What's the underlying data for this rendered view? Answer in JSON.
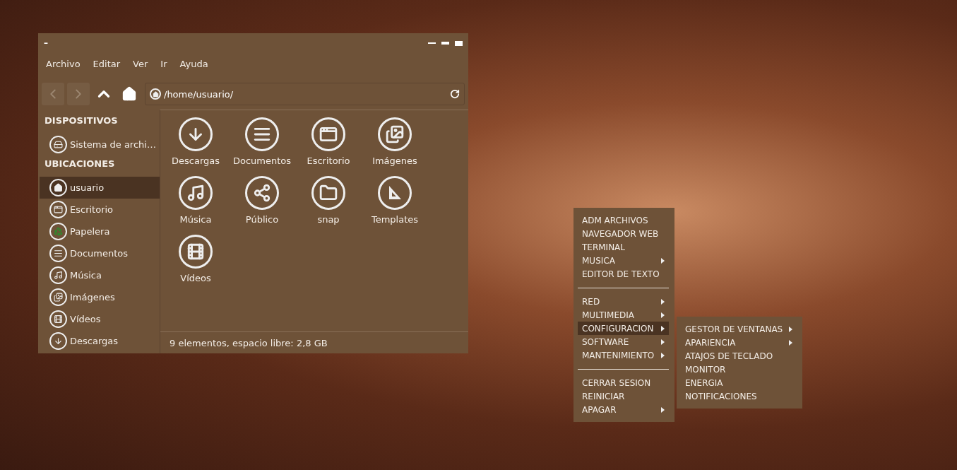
{
  "window": {
    "title": "–",
    "menu_bar": [
      "Archivo",
      "Editar",
      "Ver",
      "Ir",
      "Ayuda"
    ],
    "toolbar": {
      "back_disabled": true,
      "forward_disabled": true,
      "path": "/home/usuario/"
    },
    "sidebar": {
      "sections": [
        {
          "heading": "DISPOSITIVOS",
          "items": [
            {
              "label": "Sistema de archi…",
              "selected": false
            }
          ]
        },
        {
          "heading": "UBICACIONES",
          "items": [
            {
              "label": "usuario",
              "selected": true
            },
            {
              "label": "Escritorio",
              "selected": false
            },
            {
              "label": "Papelera",
              "selected": false
            },
            {
              "label": "Documentos",
              "selected": false
            },
            {
              "label": "Música",
              "selected": false
            },
            {
              "label": "Imágenes",
              "selected": false
            },
            {
              "label": "Vídeos",
              "selected": false
            },
            {
              "label": "Descargas",
              "selected": false
            }
          ]
        }
      ]
    },
    "files": [
      "Descargas",
      "Documentos",
      "Escritorio",
      "Imágenes",
      "Música",
      "Público",
      "snap",
      "Templates",
      "Vídeos"
    ],
    "status_bar": "9 elementos, espacio libre: 2,8 GB"
  },
  "menu": {
    "items": [
      {
        "kind": "item",
        "label": "ADM ARCHIVOS",
        "submenu": false,
        "selected": false
      },
      {
        "kind": "item",
        "label": "NAVEGADOR WEB",
        "submenu": false,
        "selected": false
      },
      {
        "kind": "item",
        "label": "TERMINAL",
        "submenu": false,
        "selected": false
      },
      {
        "kind": "item",
        "label": "MUSICA",
        "submenu": true,
        "selected": false
      },
      {
        "kind": "item",
        "label": "EDITOR DE TEXTO",
        "submenu": false,
        "selected": false
      },
      {
        "kind": "separator"
      },
      {
        "kind": "item",
        "label": "RED",
        "submenu": true,
        "selected": false
      },
      {
        "kind": "item",
        "label": "MULTIMEDIA",
        "submenu": true,
        "selected": false
      },
      {
        "kind": "item",
        "label": "CONFIGURACION",
        "submenu": true,
        "selected": true
      },
      {
        "kind": "item",
        "label": "SOFTWARE",
        "submenu": true,
        "selected": false
      },
      {
        "kind": "item",
        "label": "MANTENIMIENTO",
        "submenu": true,
        "selected": false
      },
      {
        "kind": "separator"
      },
      {
        "kind": "item",
        "label": "CERRAR SESION",
        "submenu": false,
        "selected": false
      },
      {
        "kind": "item",
        "label": "REINICIAR",
        "submenu": false,
        "selected": false
      },
      {
        "kind": "item",
        "label": "APAGAR",
        "submenu": true,
        "selected": false
      }
    ]
  },
  "submenu": {
    "items": [
      {
        "kind": "item",
        "label": "GESTOR DE VENTANAS",
        "submenu": true,
        "selected": false
      },
      {
        "kind": "item",
        "label": "APARIENCIA",
        "submenu": true,
        "selected": false
      },
      {
        "kind": "item",
        "label": "ATAJOS DE TECLADO",
        "submenu": false,
        "selected": false
      },
      {
        "kind": "item",
        "label": "MONITOR",
        "submenu": false,
        "selected": false
      },
      {
        "kind": "item",
        "label": "ENERGIA",
        "submenu": false,
        "selected": false
      },
      {
        "kind": "item",
        "label": "NOTIFICACIONES",
        "submenu": false,
        "selected": false
      }
    ]
  }
}
